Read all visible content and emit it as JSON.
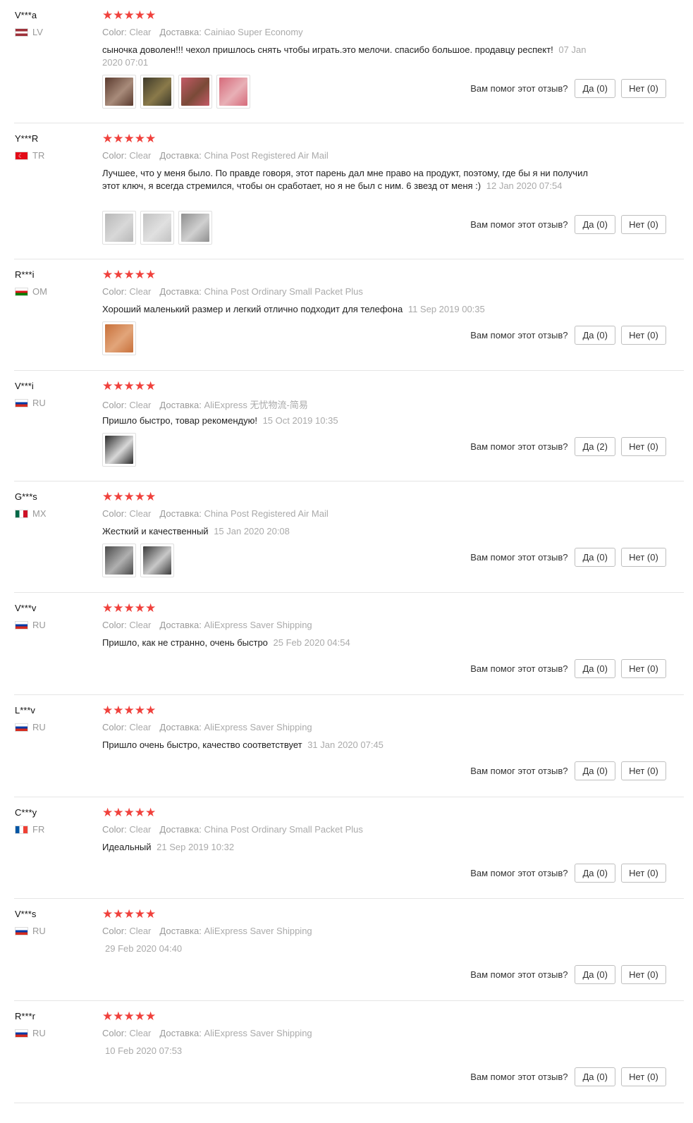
{
  "labels": {
    "color_key": "Color:",
    "delivery_key": "Доставка:",
    "helpful_question": "Вам помог этот отзыв?"
  },
  "reviews": [
    {
      "user": "V***a",
      "country": "LV",
      "flag": [
        "#9e3039",
        "#ffffff",
        "#9e3039"
      ],
      "stars": "★★★★★",
      "color": "Clear",
      "delivery": "Cainiao Super Economy",
      "text": "сыночка доволен!!! чехол пришлось снять чтобы играть.это мелочи. спасибо большое. продавцу респект!",
      "date": "07 Jan 2020 07:01",
      "photos": [
        {
          "name": "phone-case-photo",
          "colors": [
            "#5a3a2e",
            "#a88b7a"
          ]
        },
        {
          "name": "package-contents-photo",
          "colors": [
            "#3e3a2a",
            "#8a7a4a"
          ]
        },
        {
          "name": "phone-on-fabric-photo",
          "colors": [
            "#c45a66",
            "#7a4a38"
          ]
        },
        {
          "name": "case-closeup-photo",
          "colors": [
            "#d66a7a",
            "#e8b0b6"
          ]
        }
      ],
      "yes": "Да (0)",
      "no": "Нет (0)"
    },
    {
      "user": "Y***R",
      "country": "TR",
      "flag": [
        "#e30a17",
        "#e30a17",
        "#e30a17"
      ],
      "stars": "★★★★★",
      "color": "Clear",
      "delivery": "China Post Registered Air Mail",
      "text": "Лучшее, что у меня было. По правде говоря, этот парень дал мне право на продукт, поэтому, где бы я ни получил этот ключ, я всегда стремился, чтобы он сработает, но я не был с ним. 6 звезд от меня :)",
      "date": "12 Jan 2020 07:54",
      "photos": [
        {
          "name": "earbud-case-photo",
          "colors": [
            "#b8b8b8",
            "#d8d8d8"
          ]
        },
        {
          "name": "earbud-case-photo",
          "colors": [
            "#c2c2c2",
            "#e0e0e0"
          ]
        },
        {
          "name": "earbud-case-photo",
          "colors": [
            "#8f8f8f",
            "#d0d0d0"
          ]
        }
      ],
      "yes": "Да (0)",
      "no": "Нет (0)"
    },
    {
      "user": "R***i",
      "country": "OM",
      "flag": [
        "#ffffff",
        "#db161b",
        "#008000"
      ],
      "stars": "★★★★★",
      "color": "Clear",
      "delivery": "China Post Ordinary Small Packet Plus",
      "text": "Хороший маленький размер и легкий отлично подходит для телефона",
      "date": "11 Sep 2019 00:35",
      "photos": [
        {
          "name": "hand-holding-case-photo",
          "colors": [
            "#c8703a",
            "#e2a57a"
          ]
        }
      ],
      "yes": "Да (0)",
      "no": "Нет (0)"
    },
    {
      "user": "V***i",
      "country": "RU",
      "flag": [
        "#ffffff",
        "#0039a6",
        "#d52b1e"
      ],
      "stars": "★★★★★",
      "color": "Clear",
      "delivery": "AliExpress 无忧物流-简易",
      "text": "Пришло быстро, товар рекомендую!",
      "date": "15 Oct 2019 10:35",
      "photos": [
        {
          "name": "earbuds-box-photo",
          "colors": [
            "#2a2a2a",
            "#d8d8d8"
          ]
        }
      ],
      "yes": "Да (2)",
      "no": "Нет (0)"
    },
    {
      "user": "G***s",
      "country": "MX",
      "flag": [
        "#006847",
        "#ffffff",
        "#ce1126"
      ],
      "stars": "★★★★★",
      "color": "Clear",
      "delivery": "China Post Registered Air Mail",
      "text": "Жесткий и качественный",
      "date": "15 Jan 2020 20:08",
      "photos": [
        {
          "name": "earbud-case-photo",
          "colors": [
            "#4a4a4a",
            "#b0b0b0"
          ]
        },
        {
          "name": "earbud-case-photo",
          "colors": [
            "#3a3a3a",
            "#c8c8c8"
          ]
        }
      ],
      "yes": "Да (0)",
      "no": "Нет (0)"
    },
    {
      "user": "V***v",
      "country": "RU",
      "flag": [
        "#ffffff",
        "#0039a6",
        "#d52b1e"
      ],
      "stars": "★★★★★",
      "color": "Clear",
      "delivery": "AliExpress Saver Shipping",
      "text": "Пришло, как не странно, очень быстро",
      "date": "25 Feb 2020 04:54",
      "photos": [],
      "yes": "Да (0)",
      "no": "Нет (0)"
    },
    {
      "user": "L***v",
      "country": "RU",
      "flag": [
        "#ffffff",
        "#0039a6",
        "#d52b1e"
      ],
      "stars": "★★★★★",
      "color": "Clear",
      "delivery": "AliExpress Saver Shipping",
      "text": "Пришло очень быстро, качество соответствует",
      "date": "31 Jan 2020 07:45",
      "photos": [],
      "yes": "Да (0)",
      "no": "Нет (0)"
    },
    {
      "user": "C***y",
      "country": "FR",
      "flag": [
        "#0055a4",
        "#ffffff",
        "#ef4135"
      ],
      "stars": "★★★★★",
      "color": "Clear",
      "delivery": "China Post Ordinary Small Packet Plus",
      "text": "Идеальный",
      "date": "21 Sep 2019 10:32",
      "photos": [],
      "yes": "Да (0)",
      "no": "Нет (0)"
    },
    {
      "user": "V***s",
      "country": "RU",
      "flag": [
        "#ffffff",
        "#0039a6",
        "#d52b1e"
      ],
      "stars": "★★★★★",
      "color": "Clear",
      "delivery": "AliExpress Saver Shipping",
      "text": "",
      "date": "29 Feb 2020 04:40",
      "photos": [],
      "yes": "Да (0)",
      "no": "Нет (0)"
    },
    {
      "user": "R***r",
      "country": "RU",
      "flag": [
        "#ffffff",
        "#0039a6",
        "#d52b1e"
      ],
      "stars": "★★★★★",
      "color": "Clear",
      "delivery": "AliExpress Saver Shipping",
      "text": "",
      "date": "10 Feb 2020 07:53",
      "photos": [],
      "yes": "Да (0)",
      "no": "Нет (0)"
    }
  ]
}
